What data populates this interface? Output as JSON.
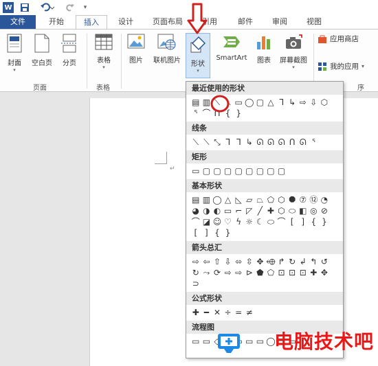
{
  "quick_access": {
    "app_icon": "word-icon",
    "save_icon": "save-icon",
    "undo_icon": "undo-icon",
    "redo_icon": "redo-icon",
    "customize_icon": "chevron-down-icon"
  },
  "tabs": [
    {
      "label": "文件"
    },
    {
      "label": "开始"
    },
    {
      "label": "插入"
    },
    {
      "label": "设计"
    },
    {
      "label": "页面布局"
    },
    {
      "label": "引用"
    },
    {
      "label": "邮件"
    },
    {
      "label": "审阅"
    },
    {
      "label": "视图"
    }
  ],
  "ribbon": {
    "buttons": [
      {
        "label": "封面"
      },
      {
        "label": "空白页"
      },
      {
        "label": "分页"
      },
      {
        "label": "表格"
      },
      {
        "label": "图片"
      },
      {
        "label": "联机图片"
      },
      {
        "label": "形状"
      },
      {
        "label": "SmartArt"
      },
      {
        "label": "图表"
      },
      {
        "label": "屏幕截图"
      }
    ],
    "groups": [
      {
        "label": "页面"
      },
      {
        "label": "表格"
      },
      {
        "label": "序"
      }
    ],
    "apps": {
      "store_label": "应用商店",
      "my_apps_label": "我的应用"
    }
  },
  "shapes_panel": {
    "sections": [
      {
        "title": "最近使用的形状",
        "shapes": [
          "▤",
          "▥",
          "⟍",
          "⟍",
          "▭",
          "◯",
          "▢",
          "△",
          "ᒣ",
          "↳",
          "⇨",
          "⇩",
          "⬡",
          "ᕐ",
          "⌒",
          "ᑎ",
          "{",
          "}"
        ]
      },
      {
        "title": "线条",
        "shapes": [
          "⟍",
          "⟍",
          "⤡",
          "ᒣ",
          "ᒣ",
          "↳",
          "ᘏ",
          "ᘏ",
          "ᘏ",
          "ᑎ",
          "ᘏ",
          "ᕐ"
        ]
      },
      {
        "title": "矩形",
        "shapes": [
          "▭",
          "▢",
          "▢",
          "▢",
          "▢",
          "▢",
          "▢",
          "▢",
          "▢"
        ]
      },
      {
        "title": "基本形状",
        "shapes": [
          "▤",
          "▥",
          "◯",
          "△",
          "◺",
          "▱",
          "⏢",
          "⬠",
          "⬡",
          "⯃",
          "⑦",
          "⑫",
          "◔",
          "◕",
          "◑",
          "◐",
          "▭",
          "⌐",
          "◸",
          "╱",
          "✚",
          "⬡",
          "⬭",
          "◧",
          "◎",
          "⊘",
          "⌒",
          "◪",
          "☺",
          "♡",
          "ϟ",
          "☼",
          "☾",
          "⬭",
          "⌒",
          "[",
          "]",
          "{",
          "}",
          "[",
          "]",
          "{",
          "}"
        ]
      },
      {
        "title": "箭头总汇",
        "shapes": [
          "⇨",
          "⇦",
          "⇧",
          "⇩",
          "⬄",
          "⇳",
          "✥",
          "⬲",
          "↱",
          "↻",
          "↲",
          "↰",
          "↺",
          "↻",
          "⤳",
          "⟳",
          "⇨",
          "⇨",
          "⊳",
          "⬟",
          "⬠",
          "⊡",
          "⊡",
          "⊡",
          "✚",
          "✥",
          "⊃"
        ]
      },
      {
        "title": "公式形状",
        "shapes": [
          "✚",
          "━",
          "✕",
          "÷",
          "=",
          "≠"
        ]
      },
      {
        "title": "流程图",
        "shapes": [
          "▭",
          "▭",
          "◇",
          "▱",
          "▭",
          "▭",
          "▭",
          "◯",
          "▭",
          "▭"
        ]
      }
    ]
  },
  "annotation": {
    "arrow_color": "#cc2222",
    "circle_color": "#cc2222"
  },
  "watermark": {
    "text": "电脑技术吧"
  },
  "colors": {
    "file_tab": "#2b579a",
    "accent": "#2b579a"
  }
}
